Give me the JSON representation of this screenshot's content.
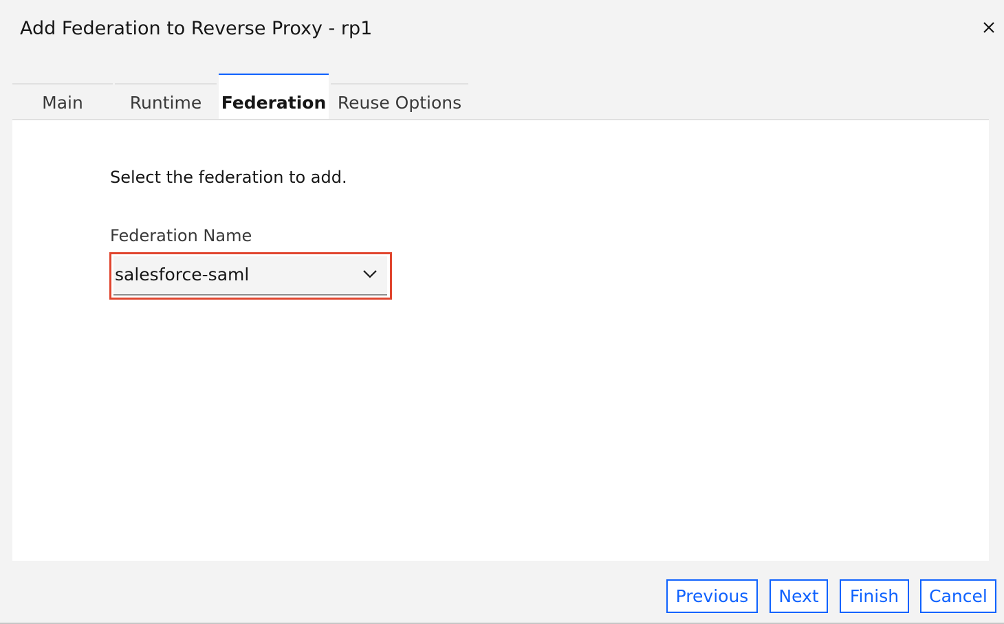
{
  "dialog": {
    "title": "Add Federation to Reverse Proxy - rp1",
    "close_icon": "close-icon"
  },
  "tabs": [
    {
      "label": "Main",
      "active": false
    },
    {
      "label": "Runtime",
      "active": false
    },
    {
      "label": "Federation",
      "active": true
    },
    {
      "label": "Reuse Options",
      "active": false
    }
  ],
  "content": {
    "instruction": "Select the federation to add.",
    "federation_field": {
      "label": "Federation Name",
      "value": "salesforce-saml",
      "icon": "chevron-down-icon"
    }
  },
  "footer": {
    "previous_label": "Previous",
    "next_label": "Next",
    "finish_label": "Finish",
    "cancel_label": "Cancel"
  },
  "colors": {
    "accent": "#0f62fe",
    "highlight": "#e0452e",
    "background": "#f3f3f3",
    "panel": "#ffffff"
  }
}
